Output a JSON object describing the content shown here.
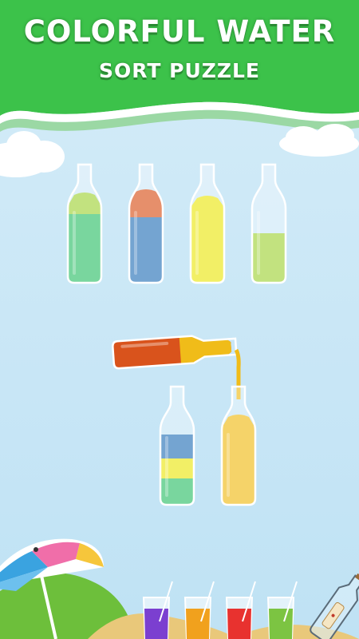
{
  "header": {
    "title_line1": "COLORFUL WATER",
    "title_line2": "SORT PUZZLE",
    "banner_color": "#3cc24a"
  },
  "colors": {
    "green": "#32c06a",
    "blue": "#2a73b8",
    "orange": "#d9531c",
    "yellow": "#ece614",
    "lime": "#a2d33b",
    "gold": "#f0bc19"
  },
  "board": {
    "top_row": [
      {
        "id": "bottle-1",
        "layers": [
          "green",
          "lime"
        ]
      },
      {
        "id": "bottle-2",
        "layers": [
          "blue",
          "orange"
        ]
      },
      {
        "id": "bottle-3",
        "layers": [
          "yellow",
          "yellow"
        ]
      },
      {
        "id": "bottle-4",
        "layers": [
          "lime"
        ]
      }
    ],
    "pouring_bottle": {
      "id": "bottle-pour",
      "layers": [
        "orange",
        "gold"
      ]
    },
    "bottom_row": [
      {
        "id": "bottle-5",
        "layers": [
          "green",
          "yellow",
          "blue",
          "blue"
        ]
      },
      {
        "id": "bottle-6",
        "layers": [
          "gold"
        ]
      }
    ]
  },
  "decor": {
    "glasses": [
      "purple",
      "orange",
      "red",
      "green"
    ],
    "glass_colors": {
      "purple": "#7b3fd0",
      "orange": "#f1a11d",
      "red": "#e8322f",
      "green": "#7cc442"
    }
  }
}
